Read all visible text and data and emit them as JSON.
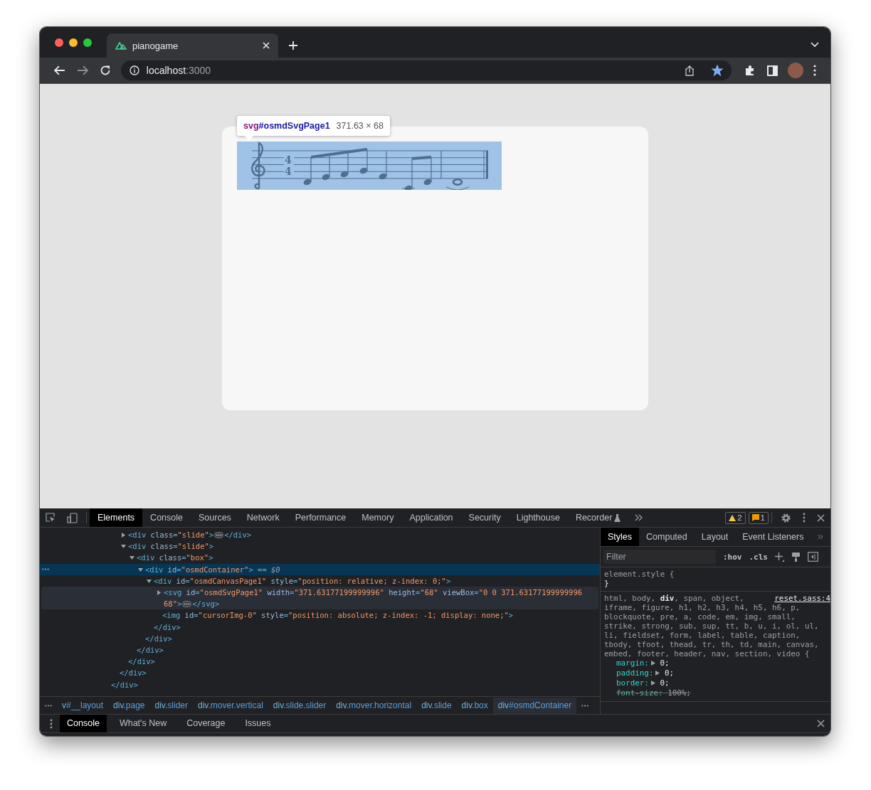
{
  "browser": {
    "tabs": [
      {
        "title": "pianogame",
        "selected": true
      }
    ],
    "url": {
      "host": "localhost",
      "port": ":3000"
    },
    "bookmarked": true
  },
  "page": {
    "tooltip": {
      "tag": "svg",
      "id": "#osmdSvgPage1",
      "size": "371.63 × 68"
    },
    "score": {
      "time_signature": [
        "4",
        "4"
      ]
    }
  },
  "devtools": {
    "tabs": [
      {
        "label": "Elements",
        "selected": true
      },
      {
        "label": "Console",
        "selected": false
      },
      {
        "label": "Sources",
        "selected": false
      },
      {
        "label": "Network",
        "selected": false
      },
      {
        "label": "Performance",
        "selected": false
      },
      {
        "label": "Memory",
        "selected": false
      },
      {
        "label": "Application",
        "selected": false
      },
      {
        "label": "Security",
        "selected": false
      },
      {
        "label": "Lighthouse",
        "selected": false
      },
      {
        "label": "Recorder",
        "selected": false
      }
    ],
    "warnings": "2",
    "issues": "1",
    "elements": {
      "tree": [
        {
          "close": "</div>",
          "children": [
            {
              "close": "</div>",
              "children": [
                {
                  "open": "<div class=\"slide\">",
                  "close": "</div>",
                  "expanded": false,
                  "selected": false,
                  "hovered": false
                },
                {
                  "open": "<div class=\"slide\">",
                  "close": "</div>",
                  "expanded": true,
                  "selected": false,
                  "hovered": false,
                  "children": [
                    {
                      "open": "<div class=\"box\">",
                      "close": "</div>",
                      "expanded": true,
                      "selected": false,
                      "hovered": false,
                      "children": [
                        {
                          "open": "<div id=\"osmdContainer\">",
                          "suffix": "== *$0*",
                          "close": "</div>",
                          "expanded": true,
                          "selected": true,
                          "hovered": false,
                          "children": [
                            {
                              "open": "<div id=\"osmdCanvasPage1\" style=\"position: relative; z-index: 0;\">",
                              "close": "</div>",
                              "expanded": true,
                              "selected": false,
                              "hovered": false,
                              "children": [
                                {
                                  "open": "<svg id=\"osmdSvgPage1\" width=\"371.63177199999996\" height=\"68\" viewBox=\"0 0 371.63177199999996 68\">",
                                  "close": "</svg>",
                                  "expanded": false,
                                  "selected": false,
                                  "hovered": true
                                },
                                {
                                  "open": "<img id=\"cursorImg-0\" style=\"position: absolute; z-index: -1; display: none;\">",
                                  "selected": false,
                                  "hovered": false
                                }
                              ]
                            }
                          ]
                        }
                      ]
                    }
                  ]
                }
              ]
            }
          ]
        }
      ]
    },
    "breadcrumbs": [
      {
        "tag": "v",
        "rest": "#__layout",
        "selected": false
      },
      {
        "tag": "div",
        "rest": ".page",
        "selected": false
      },
      {
        "tag": "div",
        "rest": ".slider",
        "selected": false
      },
      {
        "tag": "div",
        "rest": ".mover.vertical",
        "selected": false
      },
      {
        "tag": "div",
        "rest": ".slide.slider",
        "selected": false
      },
      {
        "tag": "div",
        "rest": ".mover.horizontal",
        "selected": false
      },
      {
        "tag": "div",
        "rest": ".slide",
        "selected": false
      },
      {
        "tag": "div",
        "rest": ".box",
        "selected": false
      },
      {
        "tag": "div",
        "rest": "#osmdContainer",
        "selected": true
      }
    ],
    "styles": {
      "tabs": [
        {
          "label": "Styles",
          "selected": true
        },
        {
          "label": "Computed",
          "selected": false
        },
        {
          "label": "Layout",
          "selected": false
        },
        {
          "label": "Event Listeners",
          "selected": false
        }
      ],
      "filter": {
        "placeholder": "Filter"
      },
      "hov": ":hov",
      "cls": ".cls",
      "rules": [
        {
          "selector": [
            "element.style {"
          ],
          "close": "}"
        },
        {
          "selector": [
            "html, body, **div**, span, object,",
            "iframe, figure, h1, h2, h3, h4, h5, h6, p, blockquote, pre, a, code, em, img, small, strike, strong, sub, sup, tt, b, u, i, ol, ul, li, fieldset, form, label, table, caption, tbody, tfoot, thead, tr, th, td, main, canvas, embed, footer, header, nav, section, video {"
          ],
          "source": "reset.sass:4",
          "properties": [
            {
              "name": "margin:",
              "value": "0;",
              "expandable": true,
              "overridden": false
            },
            {
              "name": "padding:",
              "value": "0;",
              "expandable": true,
              "overridden": false
            },
            {
              "name": "border:",
              "value": "0;",
              "expandable": true,
              "overridden": false
            },
            {
              "name": "font-size:",
              "value": "100%;",
              "expandable": false,
              "overridden": true
            }
          ]
        }
      ]
    },
    "drawer": {
      "tabs": [
        {
          "label": "Console",
          "selected": true
        },
        {
          "label": "What's New",
          "selected": false
        },
        {
          "label": "Coverage",
          "selected": false
        },
        {
          "label": "Issues",
          "selected": false
        }
      ]
    }
  }
}
